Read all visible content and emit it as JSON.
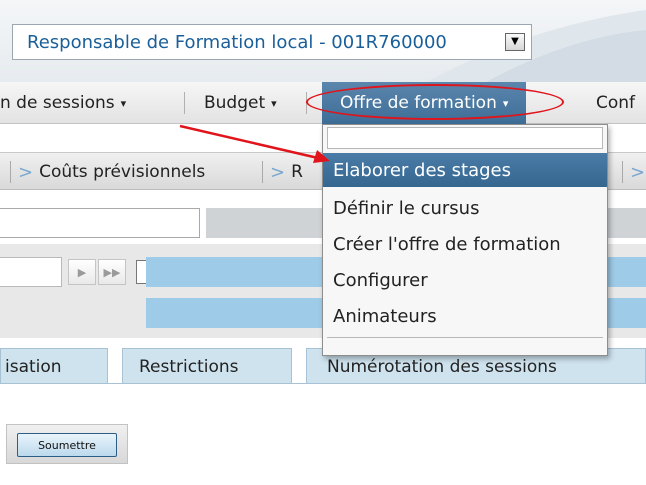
{
  "header": {
    "profile_select_value": "Responsable de Formation local - 001R760000"
  },
  "menubar": {
    "items": [
      {
        "label": "n de sessions"
      },
      {
        "label": "Budget"
      },
      {
        "label": "Offre de formation"
      },
      {
        "label": "Conf"
      }
    ]
  },
  "toolbar": {
    "items": [
      {
        "label": "Coûts prévisionnels"
      },
      {
        "label": "R"
      }
    ]
  },
  "dropdown": {
    "items": [
      {
        "label": "Elaborer des stages",
        "selected": true
      },
      {
        "label": "Définir le cursus"
      },
      {
        "label": "Créer l'offre de formation"
      },
      {
        "label": "Configurer"
      },
      {
        "label": "Animateurs"
      }
    ]
  },
  "tabs": [
    {
      "label": "isation"
    },
    {
      "label": "Restrictions"
    },
    {
      "label": "Numérotation des sessions"
    }
  ],
  "actions": {
    "submit_label": "Soumettre"
  },
  "colors": {
    "accent_blue": "#3d6d97",
    "annotation_red": "#e0141a",
    "light_blue": "#9ecbe8"
  }
}
